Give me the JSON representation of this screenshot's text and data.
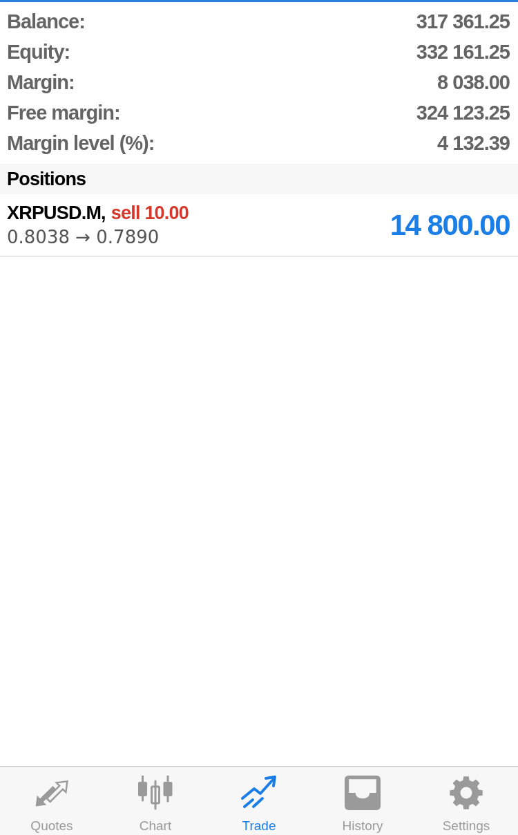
{
  "account": [
    {
      "label": "Balance:",
      "value": "317 361.25"
    },
    {
      "label": "Equity:",
      "value": "332 161.25"
    },
    {
      "label": "Margin:",
      "value": "8 038.00"
    },
    {
      "label": "Free margin:",
      "value": "324 123.25"
    },
    {
      "label": "Margin level (%):",
      "value": "4 132.39"
    }
  ],
  "positions": {
    "title": "Positions",
    "items": [
      {
        "symbol": "XRPUSD.M,",
        "side": "sell",
        "volume": "10.00",
        "prices": "0.8038 → 0.7890",
        "profit": "14 800.00",
        "positive": true
      }
    ]
  },
  "tabs": [
    {
      "label": "Quotes",
      "selected": false
    },
    {
      "label": "Chart",
      "selected": false
    },
    {
      "label": "Trade",
      "selected": true
    },
    {
      "label": "History",
      "selected": false
    },
    {
      "label": "Settings",
      "selected": false
    }
  ]
}
